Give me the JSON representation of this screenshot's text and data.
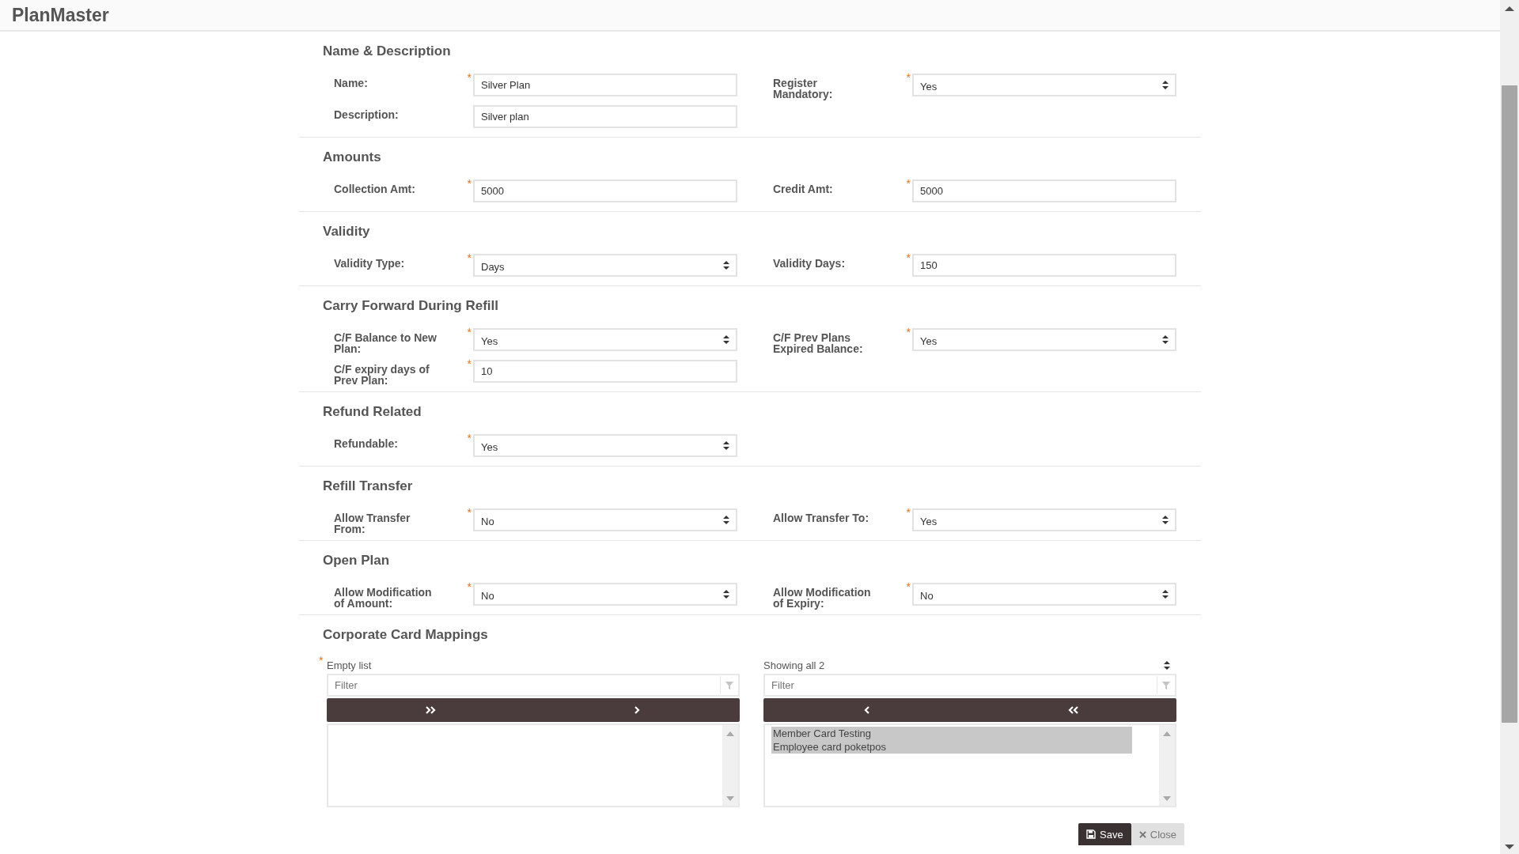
{
  "app": {
    "title": "PlanMaster"
  },
  "sections": [
    {
      "title": "Name & Description",
      "fields": [
        {
          "label": "Name:",
          "required_mark": "*",
          "kind": "text",
          "value": "Silver Plan"
        },
        {
          "label": "Register Mandatory:",
          "required_mark": "*",
          "kind": "select",
          "value": "Yes"
        },
        {
          "label": "Description:",
          "kind": "text",
          "value": "Silver plan"
        }
      ]
    },
    {
      "title": "Amounts",
      "fields": [
        {
          "label": "Collection Amt:",
          "required_mark": "*",
          "kind": "text",
          "value": "5000"
        },
        {
          "label": "Credit Amt:",
          "required_mark": "*",
          "kind": "text",
          "value": "5000"
        }
      ]
    },
    {
      "title": "Validity",
      "fields": [
        {
          "label": "Validity Type:",
          "required_mark": "*",
          "kind": "select",
          "value": "Days"
        },
        {
          "label": "Validity Days:",
          "required_mark": "*",
          "kind": "text",
          "value": "150"
        }
      ]
    },
    {
      "title": "Carry Forward During Refill",
      "fields": [
        {
          "label": "C/F Balance to New Plan:",
          "required_mark": "*",
          "kind": "select",
          "value": "Yes"
        },
        {
          "label": "C/F Prev Plans Expired Balance:",
          "required_mark": "*",
          "kind": "select",
          "value": "Yes"
        },
        {
          "label": "C/F expiry days of Prev Plan:",
          "required_mark": "*",
          "kind": "text",
          "value": "10"
        }
      ]
    },
    {
      "title": "Refund Related",
      "fields": [
        {
          "label": "Refundable:",
          "required_mark": "*",
          "kind": "select",
          "value": "Yes"
        }
      ]
    },
    {
      "title": "Refill Transfer",
      "fields": [
        {
          "label": "Allow Transfer From:",
          "required_mark": "*",
          "kind": "select",
          "value": "No"
        },
        {
          "label": "Allow Transfer To:",
          "required_mark": "*",
          "kind": "select",
          "value": "Yes"
        }
      ]
    },
    {
      "title": "Open Plan",
      "fields": [
        {
          "label": "Allow Modification of Amount:",
          "required_mark": "*",
          "kind": "select",
          "value": "No"
        },
        {
          "label": "Allow Modification of Expiry:",
          "required_mark": "*",
          "kind": "select",
          "value": "No"
        }
      ]
    }
  ],
  "corporate_card_mappings": {
    "title": "Corporate Card Mappings",
    "lists": [
      {
        "label": "Empty list",
        "required_mark": "*",
        "filter_placeholder": "Filter",
        "buttons": [
          {
            "kind": "move-all-right"
          },
          {
            "kind": "move-right"
          }
        ]
      },
      {
        "label": "Showing all 2",
        "sortable": true,
        "filter_placeholder": "Filter",
        "buttons": [
          {
            "kind": "move-left"
          },
          {
            "kind": "move-all-left"
          }
        ],
        "items": [
          {
            "text": "Member Card Testing",
            "selected": true
          },
          {
            "text": "Employee card poketpos",
            "selected": true
          }
        ]
      }
    ]
  },
  "actions": [
    {
      "label": "Save",
      "kind": "save"
    },
    {
      "label": "Close",
      "kind": "close"
    }
  ]
}
